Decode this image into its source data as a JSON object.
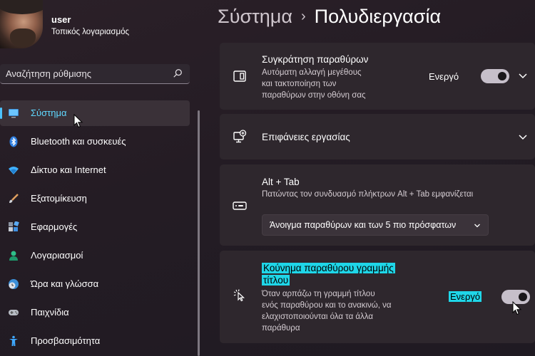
{
  "user": {
    "name": "user",
    "account_type": "Τοπικός λογαριασμός"
  },
  "search": {
    "placeholder": "Αναζήτηση ρύθμισης"
  },
  "nav": {
    "items": [
      {
        "label": "Σύστημα",
        "icon": "monitor-icon"
      },
      {
        "label": "Bluetooth και συσκευές",
        "icon": "bluetooth-icon"
      },
      {
        "label": "Δίκτυο και Internet",
        "icon": "wifi-icon"
      },
      {
        "label": "Εξατομίκευση",
        "icon": "brush-icon"
      },
      {
        "label": "Εφαρμογές",
        "icon": "apps-icon"
      },
      {
        "label": "Λογαριασμοί",
        "icon": "person-icon"
      },
      {
        "label": "Ώρα και γλώσσα",
        "icon": "globe-clock-icon"
      },
      {
        "label": "Παιχνίδια",
        "icon": "gamepad-icon"
      },
      {
        "label": "Προσβασιμότητα",
        "icon": "accessibility-icon"
      }
    ],
    "active_index": 0
  },
  "breadcrumb": {
    "parent": "Σύστημα",
    "separator": "›",
    "current": "Πολυδιεργασία"
  },
  "cards": {
    "snap": {
      "title": "Συγκράτηση παραθύρων",
      "desc1": "Αυτόματη αλλαγή μεγέθους",
      "desc2": "και τακτοποίηση των",
      "desc3": "παραθύρων στην οθόνη σας",
      "toggle_label": "Ενεργό",
      "toggle_on": true
    },
    "desktops": {
      "title": "Επιφάνειες εργασίας"
    },
    "alttab": {
      "title": "Alt + Tab",
      "desc": "Πατώντας τον συνδυασμό πλήκτρων Alt + Tab εμφανίζεται",
      "dropdown_value": "Άνοιγμα παραθύρων και των 5 πιο πρόσφατων"
    },
    "shake": {
      "title1": "Κούνημα παραθύρου γραμμής",
      "title2": "τίτλου",
      "desc1": "Όταν αρπάζω τη γραμμή τίτλου",
      "desc2": "ενός παραθύρου και το ανακινώ, να",
      "desc3": "ελαχιστοποιούνται όλα τα άλλα",
      "desc4": "παράθυρα",
      "toggle_label": "Ενεργό",
      "toggle_on": true
    }
  },
  "colors": {
    "accent": "#4cc2ff",
    "highlight": "#1fd6e8",
    "card": "#2e272d"
  }
}
